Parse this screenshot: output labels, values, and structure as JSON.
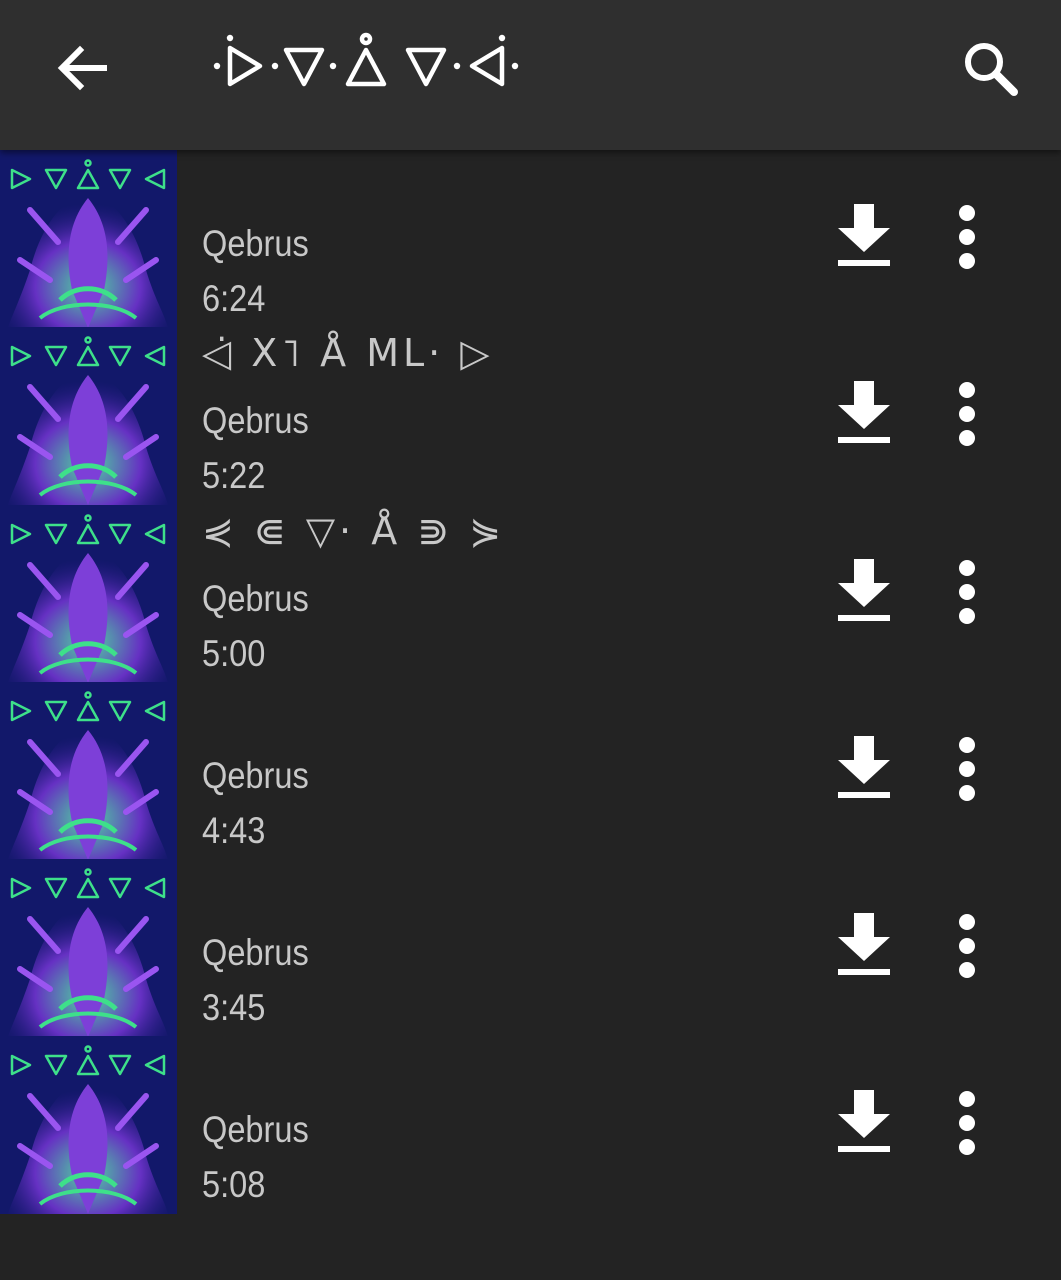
{
  "appbar": {
    "back_icon": "arrow-back-icon",
    "search_icon": "search-icon",
    "title_glyphs": "·▷·▽·Å·▽·◁·"
  },
  "colors": {
    "background": "#232323",
    "appbar": "#2f2f2f",
    "text": "#c8c8c8",
    "icon": "#ffffff",
    "art_bg": "#13196b",
    "art_accent": "#3ee08a",
    "art_figure": "#6a32c8"
  },
  "tracks": [
    {
      "title": "",
      "artist": "Qebrus",
      "duration": "6:24"
    },
    {
      "title": "◁̇ Χ˥ Å ML· ▷",
      "artist": "Qebrus",
      "duration": "5:22"
    },
    {
      "title": "⋞ ⋐ ▽· Å ⋑ ⋟",
      "artist": "Qebrus",
      "duration": "5:00"
    },
    {
      "title": "",
      "artist": "Qebrus",
      "duration": "4:43"
    },
    {
      "title": "",
      "artist": "Qebrus",
      "duration": "3:45"
    },
    {
      "title": "",
      "artist": "Qebrus",
      "duration": "5:08"
    }
  ]
}
